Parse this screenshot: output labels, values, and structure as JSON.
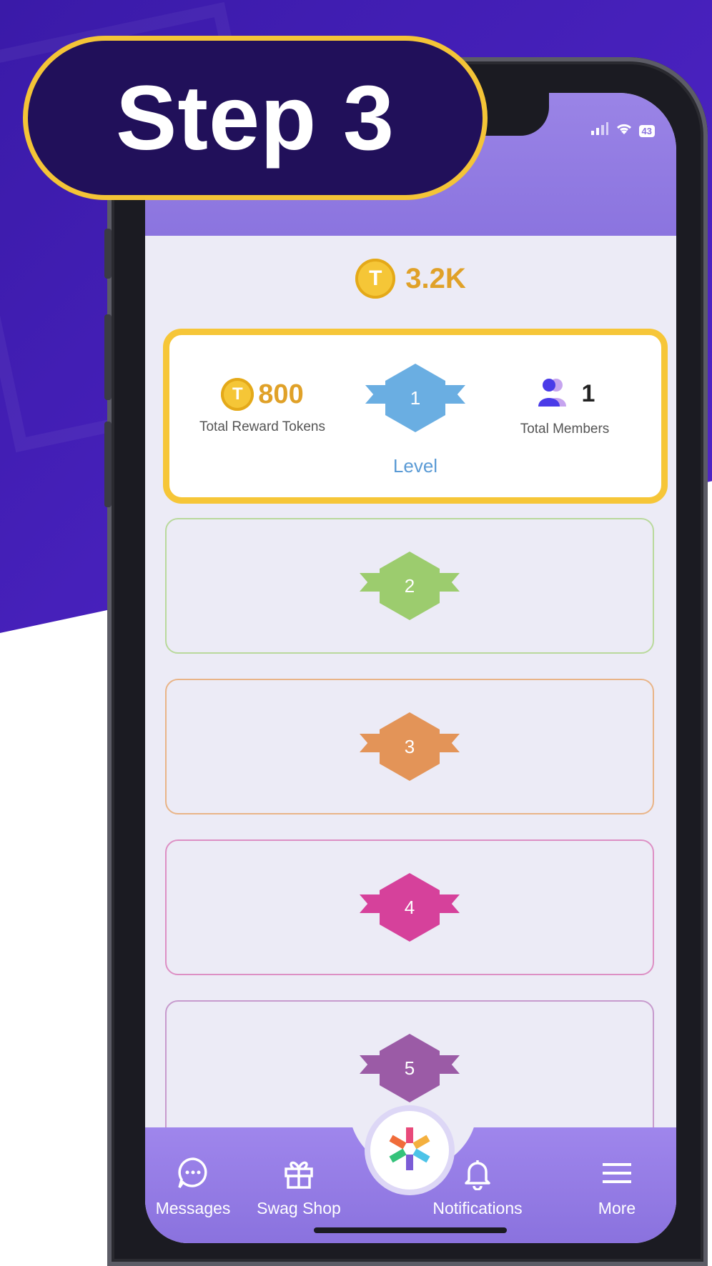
{
  "step_label": "Step 3",
  "balance": {
    "value": "3.2K",
    "coin_symbol": "T"
  },
  "level_card": {
    "tokens_value": "800",
    "tokens_label": "Total Reward Tokens",
    "level_number": "1",
    "level_label": "Level",
    "members_value": "1",
    "members_label": "Total Members"
  },
  "levels": [
    {
      "number": "2",
      "color": "#9ccc6e",
      "border": "#b9d99c"
    },
    {
      "number": "3",
      "color": "#e39458",
      "border": "#e9b487"
    },
    {
      "number": "4",
      "color": "#d6419b",
      "border": "#dd8fc4"
    },
    {
      "number": "5",
      "color": "#9b5ba6",
      "border": "#c79acd"
    }
  ],
  "level1_color": "#6aaee2",
  "nav": {
    "messages": "Messages",
    "swag_shop": "Swag Shop",
    "notifications": "Notifications",
    "more": "More"
  },
  "status": {
    "battery": "43"
  },
  "colors": {
    "accent_gold": "#f6c638",
    "header_purple": "#8b74df",
    "pill_navy": "#21105a"
  },
  "icons": [
    "messages-icon",
    "gift-icon",
    "bell-icon",
    "menu-icon",
    "members-icon",
    "coin-icon",
    "app-logo-icon"
  ]
}
